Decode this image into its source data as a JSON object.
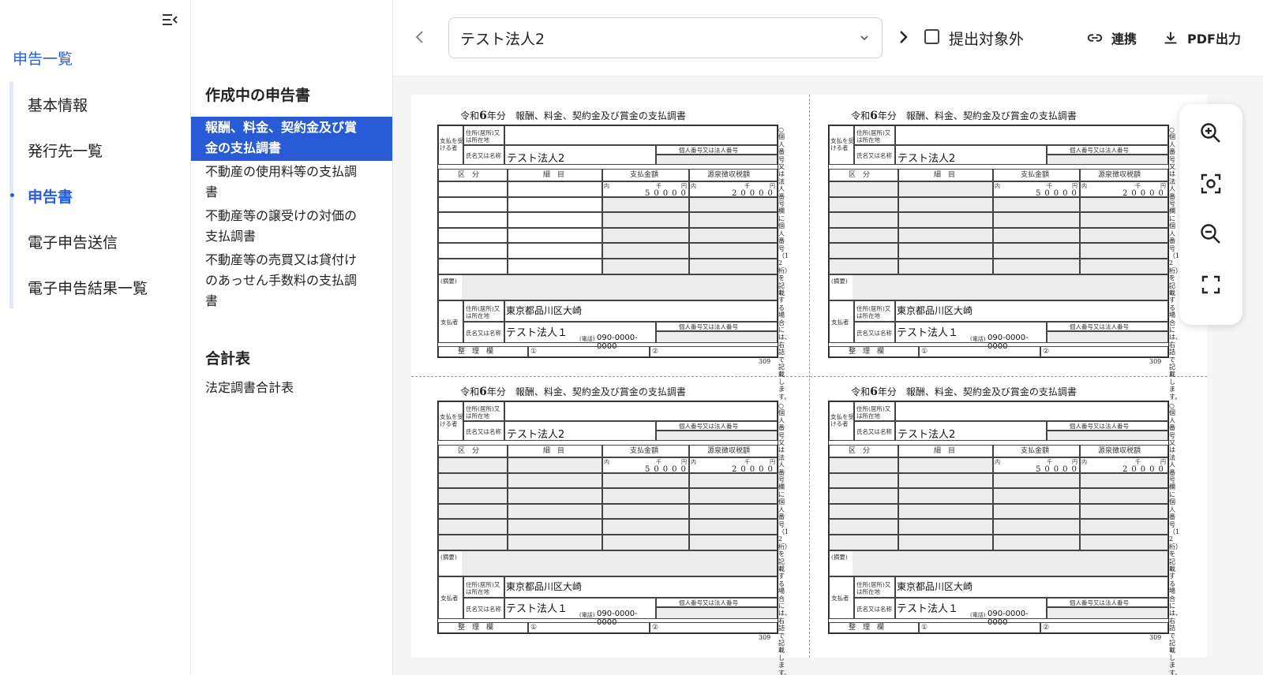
{
  "nav": {
    "title": "申告一覧",
    "items": [
      {
        "label": "基本情報",
        "active": false
      },
      {
        "label": "発行先一覧",
        "active": false
      },
      {
        "label": "申告書",
        "active": true
      },
      {
        "label": "電子申告送信",
        "active": false
      },
      {
        "label": "電子申告結果一覧",
        "active": false
      }
    ]
  },
  "docmenu": {
    "section1_title": "作成中の申告書",
    "section1_items": [
      {
        "line1": "報酬、料金、契約金及び賞",
        "line2": "金の支払調書",
        "active": true
      },
      {
        "line1": "不動産の使用料等の支払調",
        "line2": "書",
        "active": false
      },
      {
        "line1": "不動産等の譲受けの対価の",
        "line2": "支払調書",
        "active": false
      },
      {
        "line1": "不動産等の売買又は貸付け",
        "line2": "のあっせん手数料の支払調",
        "line3": "書",
        "active": false
      }
    ],
    "section2_title": "合計表",
    "section2_items": [
      {
        "label": "法定調書合計表"
      }
    ]
  },
  "toolbar": {
    "selected_entity": "テスト法人2",
    "exclude_label": "提出対象外",
    "link_label": "連携",
    "pdf_label": "PDF出力"
  },
  "form": {
    "title_prefix": "令和",
    "title_year": "6",
    "title_suffix": "年分　報酬、料金、契約金及び賞金の支払調書",
    "recipient_label": "支払を受ける者",
    "address_label": "住所(居所)又は所在地",
    "name_label": "氏名又は名称",
    "recipient_name": "テスト法人2",
    "number_label": "個人番号又は法人番号",
    "col_category": "区　分",
    "col_detail": "細　目",
    "col_amount": "支払金額",
    "col_tax": "源泉徴収税額",
    "unit_inner": "内",
    "unit_thousand": "千",
    "unit_yen": "円",
    "amount": "50000",
    "tax": "20000",
    "memo_label": "(摘要)",
    "payer_label": "支払者",
    "payer_address": "東京都品川区大崎",
    "payer_name": "テスト法人１",
    "phone_label": "(電話)",
    "phone": "090-0000-0000",
    "office_label": "整　理　欄",
    "office_1": "①",
    "office_2": "②",
    "side_note": "○個人番号又は法人番号欄に個人番号（12桁）を記載する場合には、右詰で記載します。",
    "page_no": "309"
  },
  "colors": {
    "accent": "#2a5bd7",
    "nav_bar": "#e3e9f8",
    "preview_bg": "#f5f5f5"
  },
  "icons": [
    "collapse-menu-icon",
    "chevron-left-icon",
    "chevron-down-icon",
    "chevron-right-icon",
    "link-icon",
    "download-icon",
    "zoom-in-icon",
    "fit-screen-icon",
    "zoom-out-icon",
    "fullscreen-icon"
  ]
}
